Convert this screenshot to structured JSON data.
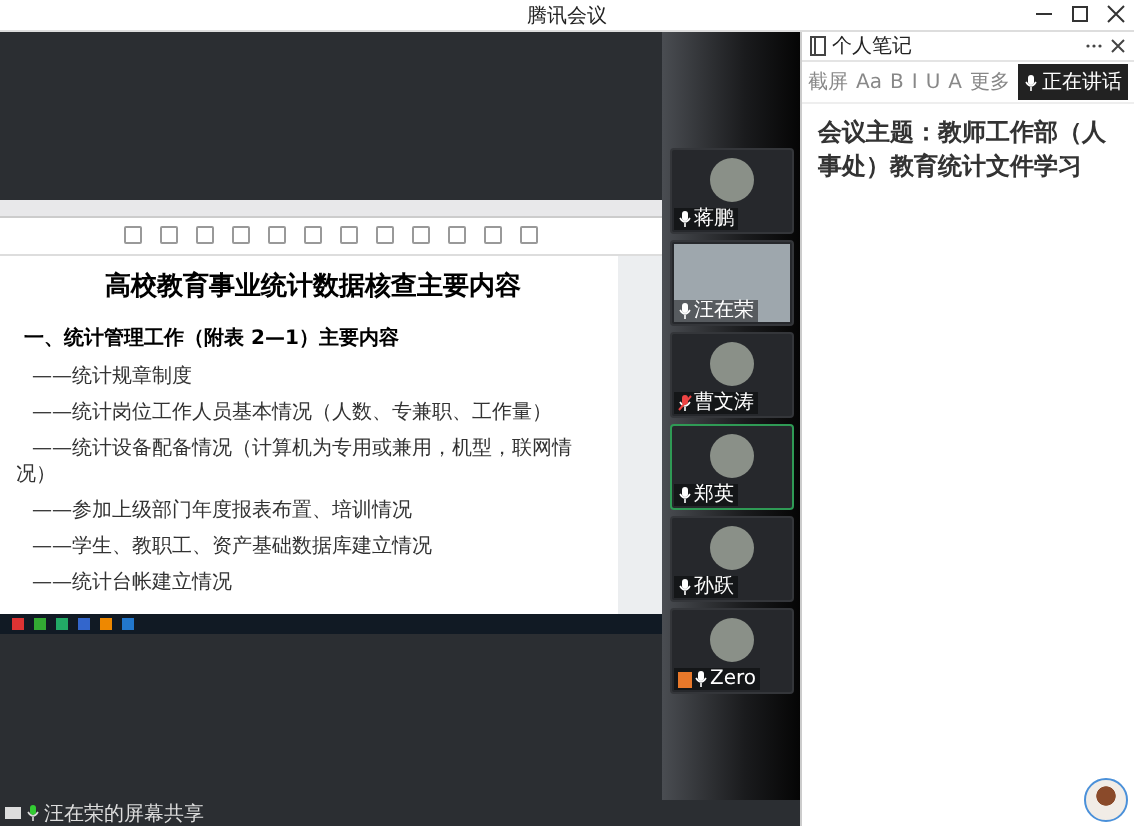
{
  "window": {
    "title": "腾讯会议"
  },
  "document": {
    "heading": "高校教育事业统计数据核查主要内容",
    "section_title": "一、统计管理工作（附表 2—1）主要内容",
    "lines": [
      "——统计规章制度",
      "——统计岗位工作人员基本情况（人数、专兼职、工作量）",
      "——统计设备配备情况（计算机为专用或兼用，机型，联网情况）",
      "——参加上级部门年度报表布置、培训情况",
      "——学生、教职工、资产基础数据库建立情况",
      "——统计台帐建立情况"
    ]
  },
  "participants": [
    {
      "name": "蒋鹏",
      "kind": "avatar",
      "mic_muted": false,
      "speaking": false,
      "host": false
    },
    {
      "name": "汪在荣",
      "kind": "video",
      "mic_muted": false,
      "speaking": false,
      "host": false
    },
    {
      "name": "曹文涛",
      "kind": "avatar",
      "mic_muted": true,
      "speaking": false,
      "host": false
    },
    {
      "name": "郑英",
      "kind": "avatar",
      "mic_muted": false,
      "speaking": true,
      "host": false
    },
    {
      "name": "孙跃",
      "kind": "avatar",
      "mic_muted": false,
      "speaking": false,
      "host": false
    },
    {
      "name": "Zero",
      "kind": "avatar",
      "mic_muted": false,
      "speaking": false,
      "host": true
    }
  ],
  "notes": {
    "title": "个人笔记",
    "toolbar": [
      "截屏",
      "Aa",
      "B",
      "I",
      "U",
      "A",
      "更多"
    ],
    "speaking_tag": "正在讲话",
    "content": "会议主题：教师工作部（人事处）教育统计文件学习"
  },
  "status_bar": {
    "text": "汪在荣的屏幕共享"
  }
}
